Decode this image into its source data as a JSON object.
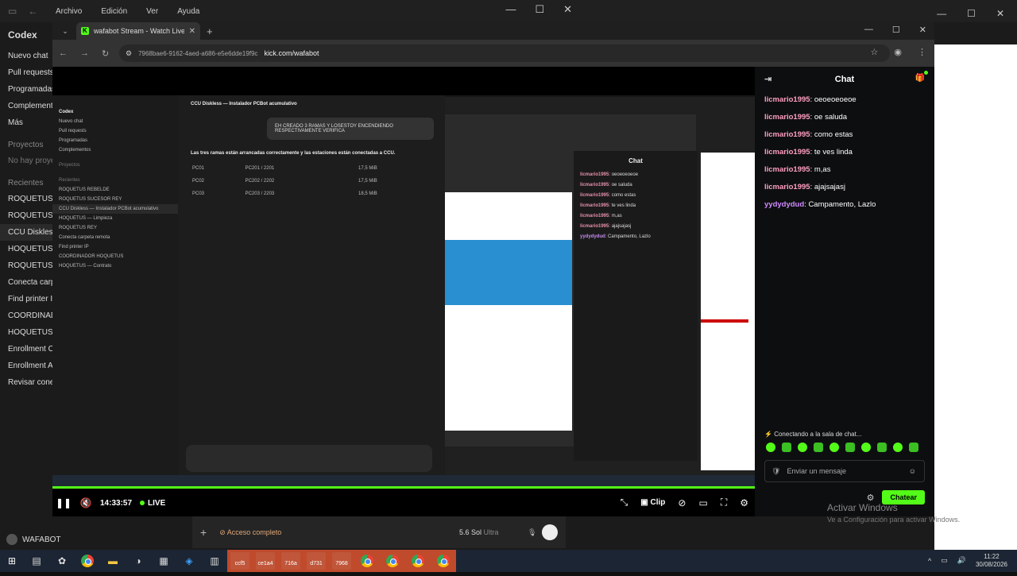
{
  "codex": {
    "menu": [
      "Archivo",
      "Edición",
      "Ver",
      "Ayuda"
    ],
    "brand": "Codex",
    "items": [
      "Nuevo chat",
      "Pull requests",
      "Programadas",
      "Complementos",
      "Más"
    ],
    "projects_label": "Proyectos",
    "no_projects": "No hay proyectos",
    "recent_label": "Recientes",
    "recent": [
      "ROQUETUS REBELDE",
      "ROQUETUS SUCESOR REY",
      "CCU Diskless",
      "HOQUETUS — Limpieza",
      "ROQUETUS REY",
      "Conecta carpeta remota",
      "Find printer IP",
      "COORDINADOR HOQUETUS",
      "HOQUETUS — Contrato",
      "Enrollment C Security",
      "Enrollment A Server",
      "Revisar conexión SMB"
    ],
    "user": "WAFABOT",
    "bottom": {
      "access": "Acceso completo",
      "model": "5.6 Sol",
      "model_variant": "Ultra"
    }
  },
  "browser": {
    "tab_title": "wafabot Stream - Watch Live on Kick",
    "url_site_id": "7968bae6-9162-4aed-a686-e5e6dde19f9c",
    "url": "kick.com/wafabot"
  },
  "stream_video": {
    "inner_title": "CCU Diskless — Instalador PCBot acumulativo",
    "inner_bubble": "EH CREADO 3 RAMAS Y LOSESTOY ENCENDIENDO RESPECTIVAMENTE VERIFICA",
    "inner_summary": "Las tres ramas están arrancadas correctamente y las estaciones están conectadas a CCU.",
    "inner_rows": [
      [
        "PC01",
        "PC201 / 2201",
        "17,5 MiB"
      ],
      [
        "PC02",
        "PC202 / 2202",
        "17,5 MiB"
      ],
      [
        "PC03",
        "PC203 / 2203",
        "18,5 MiB"
      ]
    ],
    "nested_chat_title": "Chat",
    "nested_msgs": [
      {
        "user": "licmario1995",
        "text": "oeoeoeoeoe"
      },
      {
        "user": "licmario1995",
        "text": "oe saluda"
      },
      {
        "user": "licmario1995",
        "text": "como estas"
      },
      {
        "user": "licmario1995",
        "text": "te ves linda"
      },
      {
        "user": "licmario1995",
        "text": "m,as"
      },
      {
        "user": "licmario1995",
        "text": "ajajsajasj"
      },
      {
        "user": "yydydydud",
        "text": "Campamento, Lazlo"
      }
    ]
  },
  "player": {
    "time": "14:33:57",
    "live": "LIVE",
    "clip": "Clip"
  },
  "chat": {
    "title": "Chat",
    "messages": [
      {
        "user": "licmario1995",
        "text": "oeoeoeoeoe",
        "color": "#ff9ec0"
      },
      {
        "user": "licmario1995",
        "text": "oe saluda",
        "color": "#ff9ec0"
      },
      {
        "user": "licmario1995",
        "text": "como estas",
        "color": "#ff9ec0"
      },
      {
        "user": "licmario1995",
        "text": "te ves linda",
        "color": "#ff9ec0"
      },
      {
        "user": "licmario1995",
        "text": "m,as",
        "color": "#ff9ec0"
      },
      {
        "user": "licmario1995",
        "text": "ajajsajasj",
        "color": "#ff9ec0"
      },
      {
        "user": "yydydydud",
        "text": "Campamento, Lazlo",
        "color": "#d08bff"
      }
    ],
    "connecting": "Conectando a la sala de chat...",
    "input_placeholder": "Enviar un mensaje",
    "send": "Chatear"
  },
  "watermark": {
    "title": "Activar Windows",
    "sub": "Ve a Configuración para activar Windows."
  },
  "taskbar": {
    "thumbs": [
      "ccf5",
      "ce1a4",
      "716a",
      "d731",
      "7968"
    ],
    "time": "11:22",
    "date": "30/08/2026"
  },
  "colors": {
    "kick_green": "#53fc18",
    "chat_user": "#ff9ec0",
    "chat_user2": "#d08bff"
  }
}
